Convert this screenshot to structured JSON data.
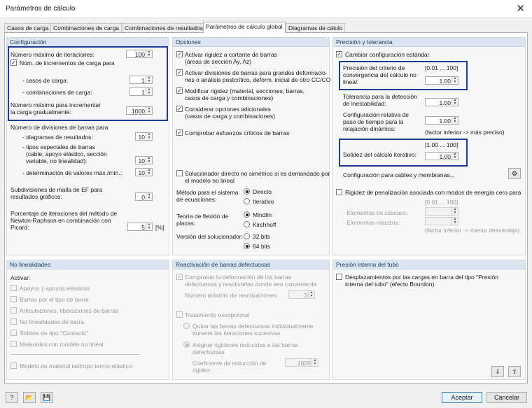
{
  "window": {
    "title": "Parámetros de cálculo",
    "close": "✕"
  },
  "tabs": [
    "Casos de carga",
    "Combinaciones de carga",
    "Combinaciones de resultados",
    "Parámetros de cálculo global",
    "Diagramas de cálulo"
  ],
  "config": {
    "header": "Configuración",
    "max_iter_label": "Número máximo de iteraciones:",
    "max_iter": "100",
    "num_incr_label": "Núm. de incrementos de carga para",
    "casos_label": "- casos de carga:",
    "casos": "1",
    "comb_label": "- combinaciones de carga:",
    "comb": "1",
    "max_incr_label1": "Número máximo para incrementar",
    "max_incr_label2": "la carga gradualmente:",
    "max_incr": "1000",
    "div_label": "Número de divisiones de barras para",
    "diag_label": "- diagramas de resultados:",
    "diag": "10",
    "tipos_label1": "- tipos especiales de barras",
    "tipos_label2": "(cable, apoyo elástico, sección",
    "tipos_label3": "variable, no linealidad):",
    "tipos": "10",
    "det_label": "- determinación de valores máx./mín.:",
    "det": "10",
    "sub_label1": "Subdivisiones de malla de EF para",
    "sub_label2": "resultados gráficos:",
    "sub": "0",
    "pct_label1": "Porcentaje de iteraciones del método de",
    "pct_label2": "Newton-Raphson en combinación con",
    "pct_label3": "Picard:",
    "pct": "5",
    "pct_unit": "[%]"
  },
  "opciones": {
    "header": "Opciones",
    "o1a": "Activar rigidez a cortante de barras",
    "o1b": "(áreas de sección Ay, Az)",
    "o2a": "Activar divisiones de barras para grandes deformacio-",
    "o2b": "nes o análisis postcrítico, deform. inicial de otro CC/CO",
    "o3a": "Modificar rigidez (material, secciones, barras,",
    "o3b": "casos de carga y combinaciones)",
    "o4a": "Considerar opciones adicionales",
    "o4b": "(casos de carga y combinaciones)",
    "o5": "Comprobar esfuerzos críticos de barras",
    "o6a": "Solucionador directo no simétrico si es demandado por",
    "o6b": "el modelo no lineal",
    "metodo_label1": "Método para el sistema",
    "metodo_label2": "de ecuaciones:",
    "metodo_r1": "Directo",
    "metodo_r2": "Iterativo",
    "teoria_label1": "Teoría de flexión de",
    "teoria_label2": "placas:",
    "teoria_r1": "Mindlin",
    "teoria_r2": "Kirchhoff",
    "version_label": "Versión del solucionador:",
    "version_r1": "32 bits",
    "version_r2": "64 bits"
  },
  "precision": {
    "header": "Precisión y tolerancia",
    "cambiar": "Cambiar configuración estándar",
    "p1a": "Precisión del criterio de",
    "p1b": "convergencia del cálculo no",
    "p1c": "lineal:",
    "p1_range": "[0.01 ... 100]",
    "p1": "1.00",
    "p2a": "Tolerancia para la detección",
    "p2b": "de inestabilidad:",
    "p2": "1.00",
    "p3a": "Configuración relativa de",
    "p3b": "paso de tiempo para la",
    "p3c": "relajación dinámica:",
    "p3": "1.00",
    "factor1": "(factor inferior -> más preciso)",
    "solidez_range": "[1.00 ... 100]",
    "solidez_label": "Solidez del cálculo iterativo:",
    "solidez": "1.00",
    "cables": "Configuración para cables y membranas...",
    "rigidez": "Rigidez de penalización asociada con modos de energía cero para",
    "rig_range": "[0.01 ... 100]",
    "rig_cascara": "- Elementos de cáscara:",
    "rig_macizos": "- Elementos macizos:",
    "factor2": "(factor inferior -> menor desventaja)"
  },
  "nolin": {
    "header": "No linealidades",
    "activar": "Activar:",
    "n1": "Apoyos y apoyos elásticos",
    "n2": "Barras por el tipo de barra",
    "n3": "Articulaciones, liberaciones de barras",
    "n4": "No linealidades de barra",
    "n5": "Sólidos de tipo \"Contacto\"",
    "n6": "Materiales con modelo no lineal",
    "n7": "Modelo de material isótropo termo-elástico"
  },
  "reactivacion": {
    "header": "Reactivación de barras defectuosas",
    "r1a": "Comprobar la deformación de las barras",
    "r1b": "defectuosas y reactivarlas donde sea conveniente",
    "rmax_label": "Número máximo de reactivaciones:",
    "rmax": "3",
    "trat": "Tratamiento excepcional",
    "q1a": "Quitar las barras defectuosas individualmente",
    "q1b": "durante las iteraciones sucesivas",
    "q2a": "Asignar rigideces reducidas a las barras",
    "q2b": "defectuosas",
    "coef_label1": "Coeficiente de reducción de",
    "coef_label2": "rigidez:",
    "coef": "1000"
  },
  "presion": {
    "header": "Presión interna del tubo",
    "p1a": "Desplazamientos por las cargas en barra del tipo \"Presión",
    "p1b": "interna del tubo\" (efecto Bourdon)"
  },
  "footer": {
    "aceptar": "Aceptar",
    "cancelar": "Cancelar"
  },
  "icons": {
    "check": "✓",
    "spin": "▲▼",
    "help": "?",
    "folder": "📂",
    "save": "💾"
  }
}
